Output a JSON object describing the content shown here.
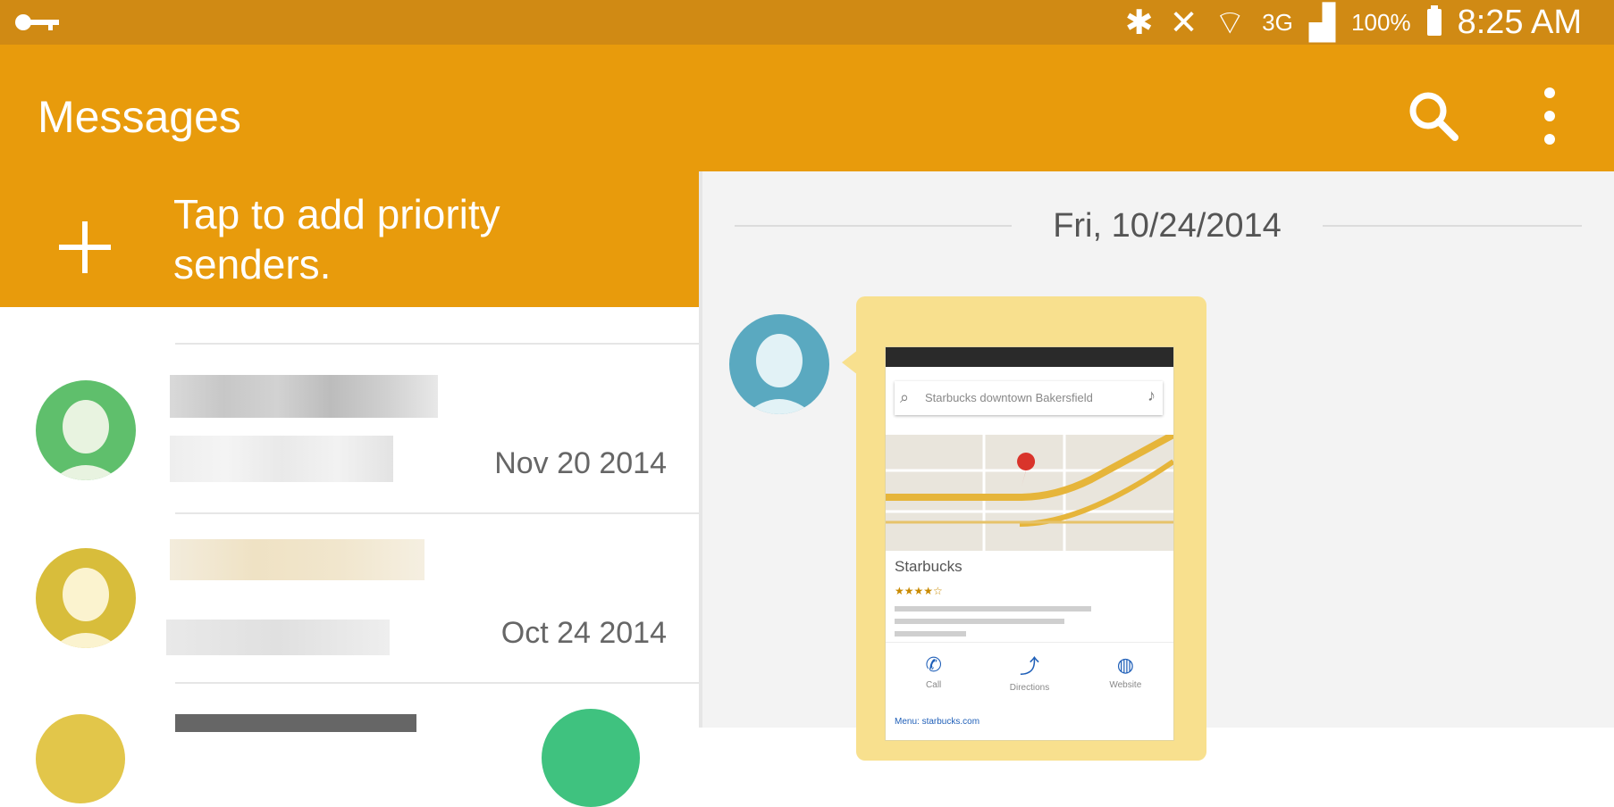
{
  "status_bar": {
    "network": "3G",
    "battery": "100%",
    "time": "8:25 AM",
    "icons": [
      "key-icon",
      "bluetooth-icon",
      "mute-icon",
      "wifi-icon",
      "signal-icon",
      "battery-icon"
    ]
  },
  "app_bar": {
    "title": "Messages",
    "actions": [
      "search-icon",
      "more-options-icon"
    ]
  },
  "priority_banner": {
    "text": "Tap to add priority senders.",
    "icon": "plus-icon"
  },
  "conversations": [
    {
      "date": "Nov 20 2014",
      "avatar_color": "#5fbf6c"
    },
    {
      "date": "Oct 24 2014",
      "avatar_color": "#d8bd3b"
    }
  ],
  "conversation_panel": {
    "date_separator": "Fri, 10/24/2014",
    "avatar_color": "#5aa9c0",
    "bubble_color": "#f8e08e",
    "attachment": {
      "search_text": "Starbucks downtown Bakersfield",
      "place_name": "Starbucks",
      "actions": [
        {
          "label": "Call",
          "icon": "phone-icon"
        },
        {
          "label": "Directions",
          "icon": "directions-icon"
        },
        {
          "label": "Website",
          "icon": "globe-icon"
        }
      ],
      "link_text": "Menu: starbucks.com"
    }
  },
  "colors": {
    "status_bar": "#d08a14",
    "app_bar": "#e89b0c",
    "fab": "#3fc27f"
  }
}
